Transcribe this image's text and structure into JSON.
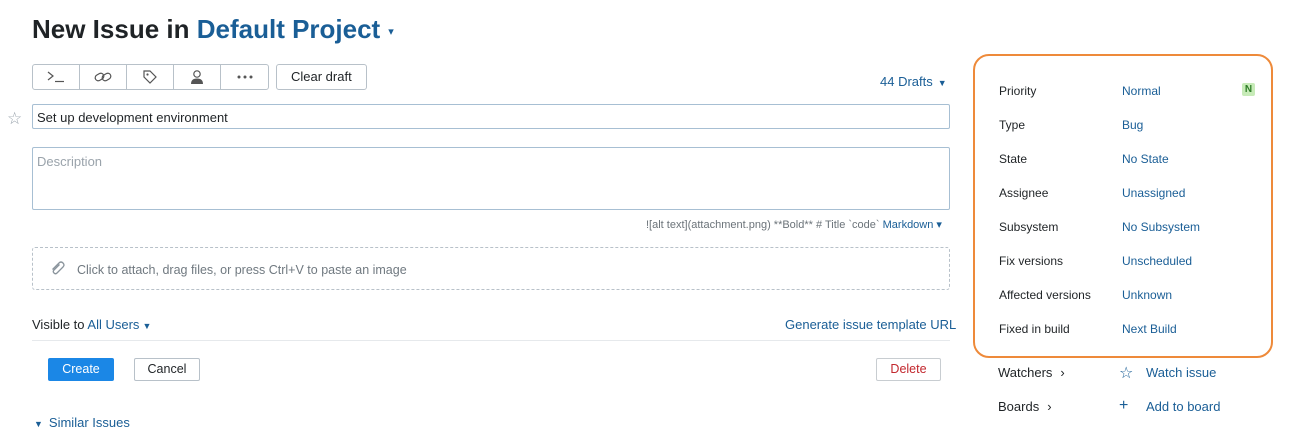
{
  "header": {
    "title_prefix": "New Issue in",
    "project": "Default Project",
    "project_caret": "▾"
  },
  "toolbar": {
    "buttons": [
      {
        "icon": "command-icon"
      },
      {
        "icon": "link-icon"
      },
      {
        "icon": "tag-icon"
      },
      {
        "icon": "user-icon"
      },
      {
        "icon": "more-icon"
      }
    ],
    "clear_draft": "Clear draft",
    "drafts": "44 Drafts"
  },
  "form": {
    "summary_value": "Set up development environment",
    "description_placeholder": "Description",
    "markdown_hint": "![alt text](attachment.png) **Bold** # Title `code`",
    "markdown_label": "Markdown",
    "attach_text": "Click to attach, drag files, or press Ctrl+V to paste an image",
    "visible_to_label": "Visible to",
    "visible_to_value": "All Users",
    "template_url": "Generate issue template URL",
    "create": "Create",
    "cancel": "Cancel",
    "delete": "Delete",
    "similar_issues": "Similar Issues"
  },
  "fields": [
    {
      "label": "Priority",
      "value": "Normal",
      "badge": "N"
    },
    {
      "label": "Type",
      "value": "Bug"
    },
    {
      "label": "State",
      "value": "No State"
    },
    {
      "label": "Assignee",
      "value": "Unassigned"
    },
    {
      "label": "Subsystem",
      "value": "No Subsystem"
    },
    {
      "label": "Fix versions",
      "value": "Unscheduled"
    },
    {
      "label": "Affected versions",
      "value": "Unknown"
    },
    {
      "label": "Fixed in build",
      "value": "Next Build"
    }
  ],
  "side": {
    "watchers_label": "Watchers",
    "watch_issue": "Watch issue",
    "boards_label": "Boards",
    "add_to_board": "Add to board"
  },
  "colors": {
    "accent": "#1a5e96",
    "primary_button": "#1b87e6",
    "highlight_border": "#ee8a3a",
    "delete_text": "#c2272d",
    "badge_bg": "#c7ebb8"
  }
}
